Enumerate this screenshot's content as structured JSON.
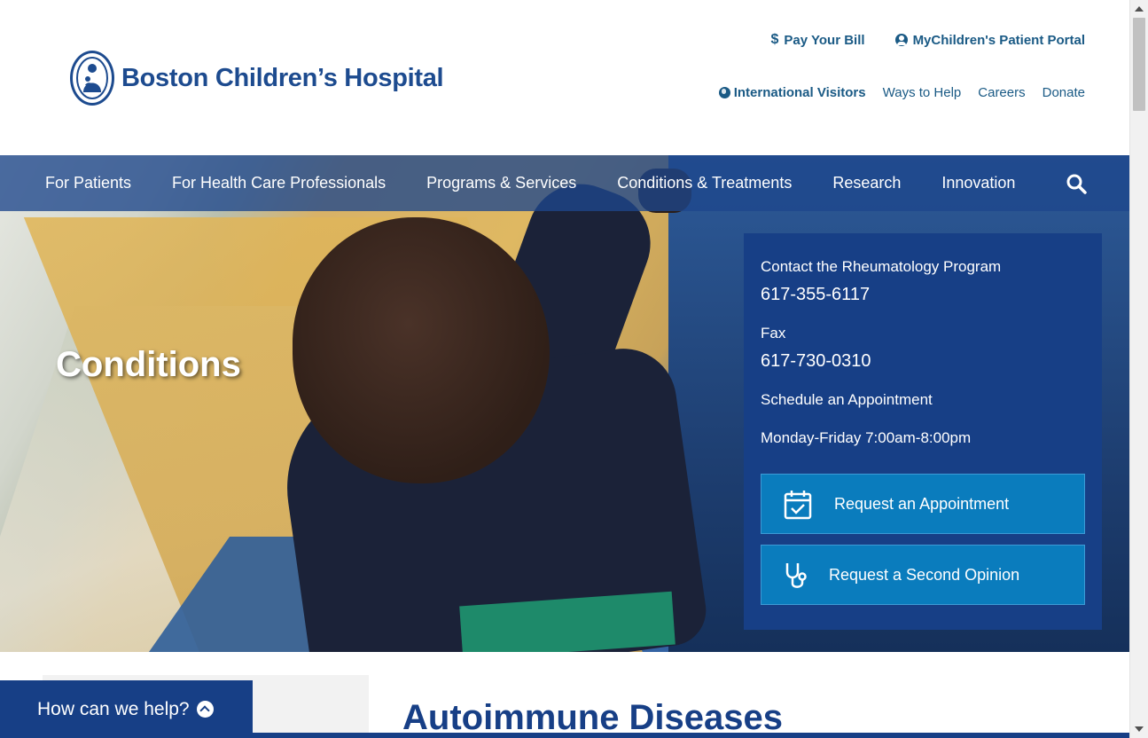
{
  "brand": {
    "name": "Boston Children’s Hospital",
    "primary_color": "#173f86",
    "link_color": "#1a5a85",
    "cta_color": "#0a7cbd"
  },
  "utility_top": {
    "pay_bill": "Pay Your Bill",
    "pay_bill_icon": "dollar-icon",
    "portal": "MyChildren's Patient Portal",
    "portal_icon": "user-circle-icon"
  },
  "utility_bottom": {
    "international": "International Visitors",
    "international_icon": "globe-icon",
    "ways_to_help": "Ways to Help",
    "careers": "Careers",
    "donate": "Donate"
  },
  "nav": {
    "items": [
      "For Patients",
      "For Health Care Professionals",
      "Programs & Services",
      "Conditions & Treatments",
      "Research",
      "Innovation"
    ],
    "search_icon": "search-icon"
  },
  "hero": {
    "title": "Conditions"
  },
  "contact": {
    "program_label": "Contact the Rheumatology Program",
    "program_phone": "617-355-6117",
    "fax_label": "Fax",
    "fax_number": "617-730-0310",
    "schedule": "Schedule an Appointment",
    "hours": "Monday-Friday 7:00am-8:00pm",
    "cta_appointment": "Request an Appointment",
    "cta_appointment_icon": "calendar-check-icon",
    "cta_second_opinion": "Request a Second Opinion",
    "cta_second_opinion_icon": "stethoscope-icon"
  },
  "main": {
    "heading": "Autoimmune Diseases"
  },
  "help_widget": {
    "label": "How can we help?",
    "icon": "chevron-up-icon"
  }
}
